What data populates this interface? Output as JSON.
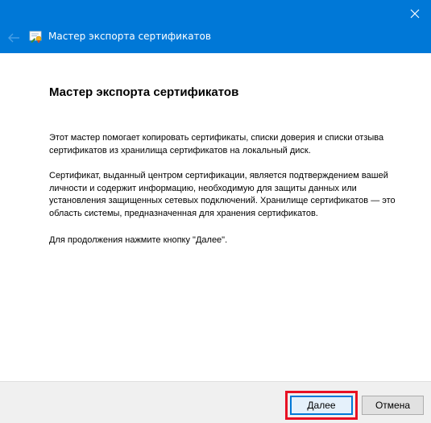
{
  "titlebar": {
    "wizard_title": "Мастер экспорта сертификатов"
  },
  "content": {
    "heading": "Мастер экспорта сертификатов",
    "paragraph_1": "Этот мастер помогает копировать сертификаты, списки доверия и списки отзыва сертификатов из хранилища сертификатов на локальный диск.",
    "paragraph_2": "Сертификат, выданный центром сертификации, является подтверждением вашей личности и содержит информацию, необходимую для защиты данных или установления защищенных сетевых подключений. Хранилище сертификатов — это область системы, предназначенная для хранения сертификатов.",
    "paragraph_3": "Для продолжения нажмите кнопку \"Далее\"."
  },
  "footer": {
    "next_label": "Далее",
    "cancel_label": "Отмена"
  },
  "icons": {
    "close": "close-icon",
    "back": "back-arrow-icon",
    "app": "certificate-icon"
  },
  "colors": {
    "titlebar": "#0078d7",
    "highlight": "#e81123",
    "footer": "#f0f0f0"
  }
}
